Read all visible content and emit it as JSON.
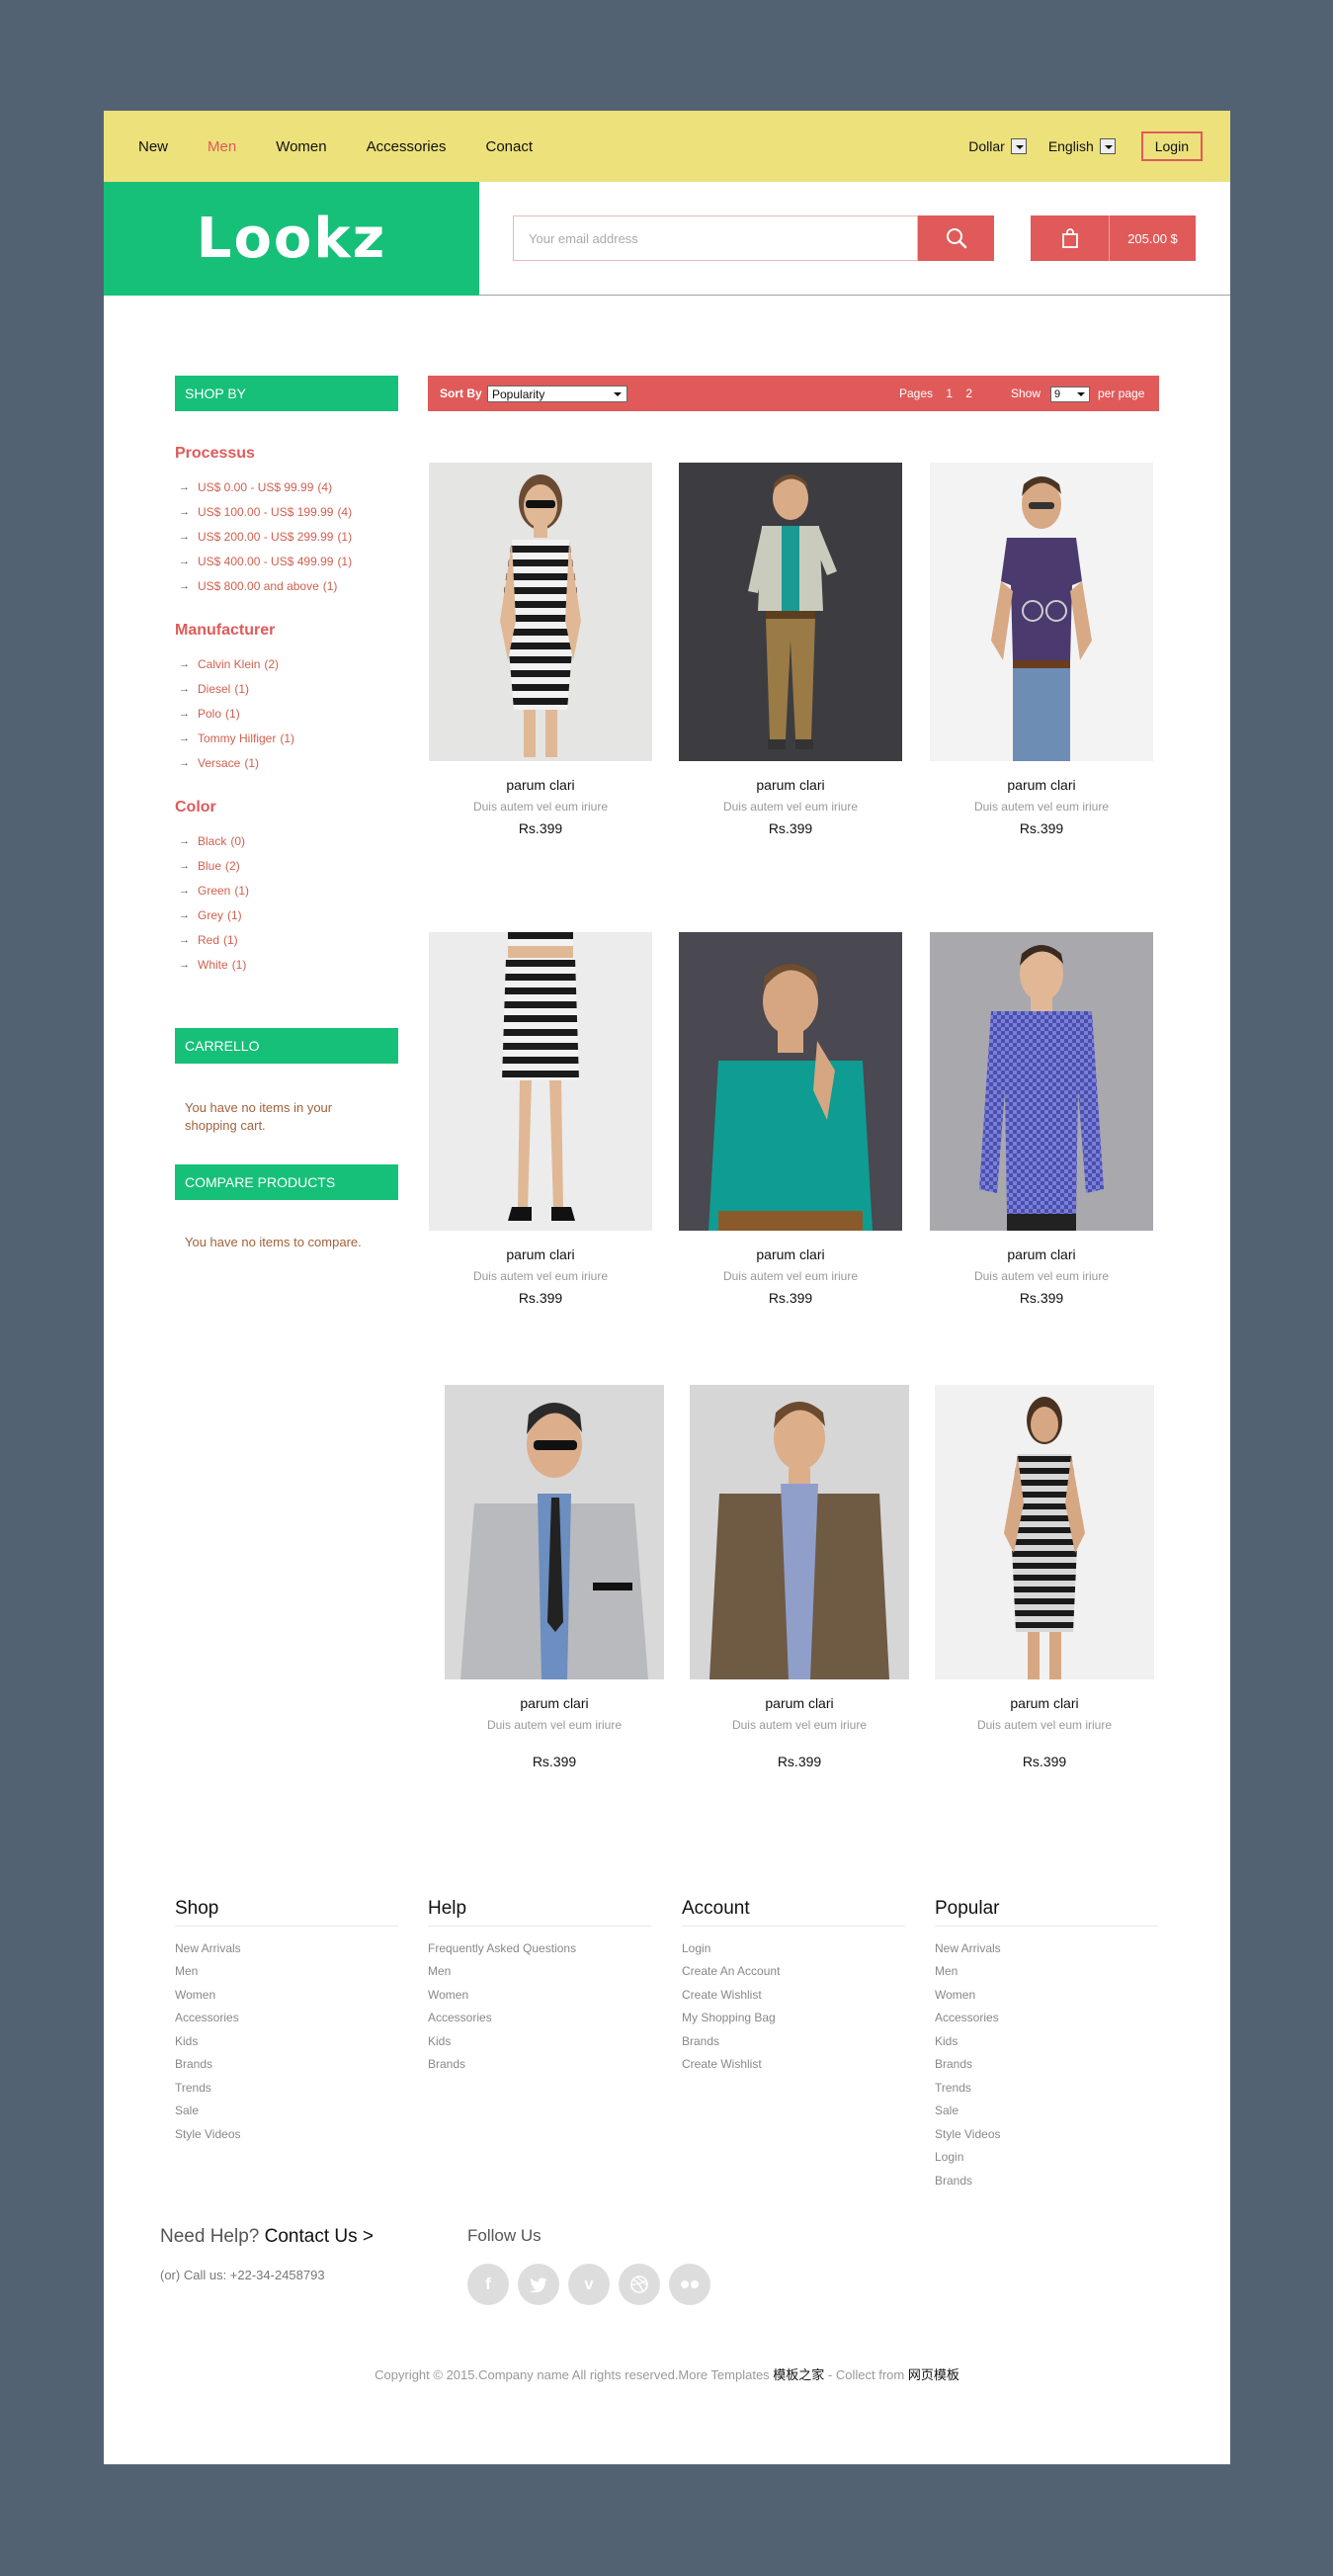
{
  "topbar": {
    "nav": [
      "New",
      "Men",
      "Women",
      "Accessories",
      "Conact"
    ],
    "active_nav": "Men",
    "currency": "Dollar",
    "language": "English",
    "login": "Login"
  },
  "header": {
    "logo": "Lookz",
    "search_placeholder": "Your email address",
    "cart_total": "205.00 $"
  },
  "sidebar": {
    "shop_by": "SHOP BY",
    "groups": [
      {
        "title": "Processus",
        "items": [
          {
            "label": "US$ 0.00 - US$ 99.99",
            "count": "(4)"
          },
          {
            "label": "US$ 100.00 - US$ 199.99",
            "count": "(4)"
          },
          {
            "label": "US$ 200.00 - US$ 299.99",
            "count": "(1)"
          },
          {
            "label": "US$ 400.00 - US$ 499.99",
            "count": "(1)"
          },
          {
            "label": "US$ 800.00 and above",
            "count": "(1)"
          }
        ]
      },
      {
        "title": "Manufacturer",
        "items": [
          {
            "label": "Calvin Klein",
            "count": "(2)"
          },
          {
            "label": "Diesel",
            "count": "(1)"
          },
          {
            "label": "Polo",
            "count": "(1)"
          },
          {
            "label": "Tommy Hilfiger",
            "count": "(1)"
          },
          {
            "label": "Versace",
            "count": "(1)"
          }
        ]
      },
      {
        "title": "Color",
        "items": [
          {
            "label": "Black",
            "count": "(0)"
          },
          {
            "label": "Blue",
            "count": "(2)"
          },
          {
            "label": "Green",
            "count": "(1)"
          },
          {
            "label": "Grey",
            "count": "(1)"
          },
          {
            "label": "Red",
            "count": "(1)"
          },
          {
            "label": "White",
            "count": "(1)"
          }
        ]
      }
    ],
    "cart_title": "CARRELLO",
    "cart_empty": "You have no items in your shopping cart.",
    "compare_title": "COMPARE PRODUCTS",
    "compare_empty": "You have no items to compare."
  },
  "sortbar": {
    "sort_by": "Sort By",
    "sort_value": "Popularity",
    "pages_label": "Pages",
    "pages": [
      "1",
      "2"
    ],
    "show_label": "Show",
    "show_value": "9",
    "per_page": "per page"
  },
  "products": [
    {
      "name": "parum clari",
      "desc": "Duis autem vel eum iriure",
      "price": "Rs.399"
    },
    {
      "name": "parum clari",
      "desc": "Duis autem vel eum iriure",
      "price": "Rs.399"
    },
    {
      "name": "parum clari",
      "desc": "Duis autem vel eum iriure",
      "price": "Rs.399"
    },
    {
      "name": "parum clari",
      "desc": "Duis autem vel eum iriure",
      "price": "Rs.399"
    },
    {
      "name": "parum clari",
      "desc": "Duis autem vel eum iriure",
      "price": "Rs.399"
    },
    {
      "name": "parum clari",
      "desc": "Duis autem vel eum iriure",
      "price": "Rs.399"
    },
    {
      "name": "parum clari",
      "desc": "Duis autem vel eum iriure",
      "price": "Rs.399"
    },
    {
      "name": "parum clari",
      "desc": "Duis autem vel eum iriure",
      "price": "Rs.399"
    },
    {
      "name": "parum clari",
      "desc": "Duis autem vel eum iriure",
      "price": "Rs.399"
    }
  ],
  "footer": {
    "columns": [
      {
        "title": "Shop",
        "links": [
          "New Arrivals",
          "Men",
          "Women",
          "Accessories",
          "Kids",
          "Brands",
          "Trends",
          "Sale",
          "Style Videos"
        ]
      },
      {
        "title": "Help",
        "links": [
          "Frequently Asked Questions",
          "Men",
          "Women",
          "Accessories",
          "Kids",
          "Brands"
        ]
      },
      {
        "title": "Account",
        "links": [
          "Login",
          "Create An Account",
          "Create Wishlist",
          "My Shopping Bag",
          "Brands",
          "Create Wishlist"
        ]
      },
      {
        "title": "Popular",
        "links": [
          "New Arrivals",
          "Men",
          "Women",
          "Accessories",
          "Kids",
          "Brands",
          "Trends",
          "Sale",
          "Style Videos",
          "Login",
          "Brands"
        ]
      }
    ],
    "need_help": "Need Help?",
    "contact_us": "Contact Us >",
    "call_us": "(or) Call us: +22-34-2458793",
    "follow_us": "Follow Us",
    "socials": [
      "facebook-icon",
      "twitter-icon",
      "vimeo-icon",
      "dribbble-icon",
      "flickr-icon"
    ],
    "copyright": "Copyright © 2015.Company name All rights reserved.More Templates",
    "link1": "模板之家",
    "collect": " - Collect from",
    "link2": "网页模板"
  },
  "colors": {
    "accent": "#e05a5a",
    "brand": "#16c079",
    "topbar": "#ece17b",
    "bg": "#536273"
  }
}
